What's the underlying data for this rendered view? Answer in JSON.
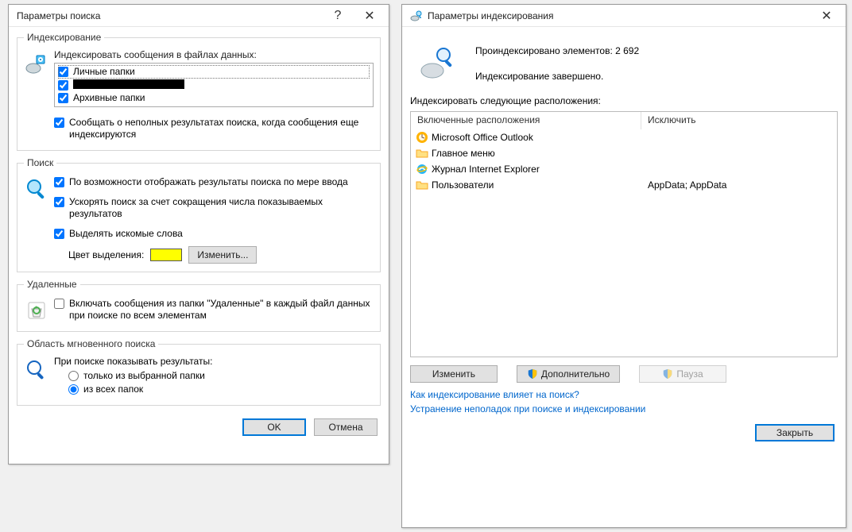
{
  "left": {
    "title": "Параметры поиска",
    "indexing": {
      "legend": "Индексирование",
      "intro": "Индексировать сообщения в файлах данных:",
      "items": [
        {
          "label": "Личные папки",
          "checked": true
        },
        {
          "label_redacted": true,
          "checked": true
        },
        {
          "label": "Архивные папки",
          "checked": true
        }
      ],
      "incomplete": {
        "label": "Сообщать о неполных результатах поиска, когда сообщения еще индексируются",
        "checked": true
      }
    },
    "search": {
      "legend": "Поиск",
      "asYouType": {
        "label": "По возможности отображать результаты поиска по мере ввода",
        "checked": true
      },
      "speedUp": {
        "label": "Ускорять поиск за счет сокращения числа показываемых результатов",
        "checked": true
      },
      "highlight": {
        "label": "Выделять искомые слова",
        "checked": true
      },
      "colorLabel": "Цвет выделения:",
      "color": "#ffff00",
      "changeBtn": "Изменить..."
    },
    "deleted": {
      "legend": "Удаленные",
      "includeDeleted": {
        "label": "Включать сообщения из папки \"Удаленные\" в каждый файл данных при поиске по всем элементам",
        "checked": false
      }
    },
    "scope": {
      "legend": "Область мгновенного поиска",
      "intro": "При поиске показывать результаты:",
      "options": [
        {
          "label": "только из выбранной папки",
          "selected": false
        },
        {
          "label": "из всех папок",
          "selected": true
        }
      ]
    },
    "ok": "OK",
    "cancel": "Отмена"
  },
  "right": {
    "title": "Параметры индексирования",
    "status": {
      "line1": "Проиндексировано элементов: 2 692",
      "line2": "Индексирование завершено."
    },
    "locationsLabel": "Индексировать следующие расположения:",
    "headers": {
      "included": "Включенные расположения",
      "exclude": "Исключить"
    },
    "rows": [
      {
        "icon": "outlook",
        "name": "Microsoft Office Outlook",
        "exclude": ""
      },
      {
        "icon": "folder",
        "name": "Главное меню",
        "exclude": ""
      },
      {
        "icon": "ie",
        "name": "Журнал Internet Explorer",
        "exclude": ""
      },
      {
        "icon": "folder",
        "name": "Пользователи",
        "exclude": "AppData; AppData"
      }
    ],
    "modifyBtn": "Изменить",
    "advancedBtn": "Дополнительно",
    "pauseBtn": "Пауза",
    "link1": "Как индексирование влияет на поиск?",
    "link2": "Устранение неполадок при поиске и индексировании",
    "closeBtn": "Закрыть"
  }
}
